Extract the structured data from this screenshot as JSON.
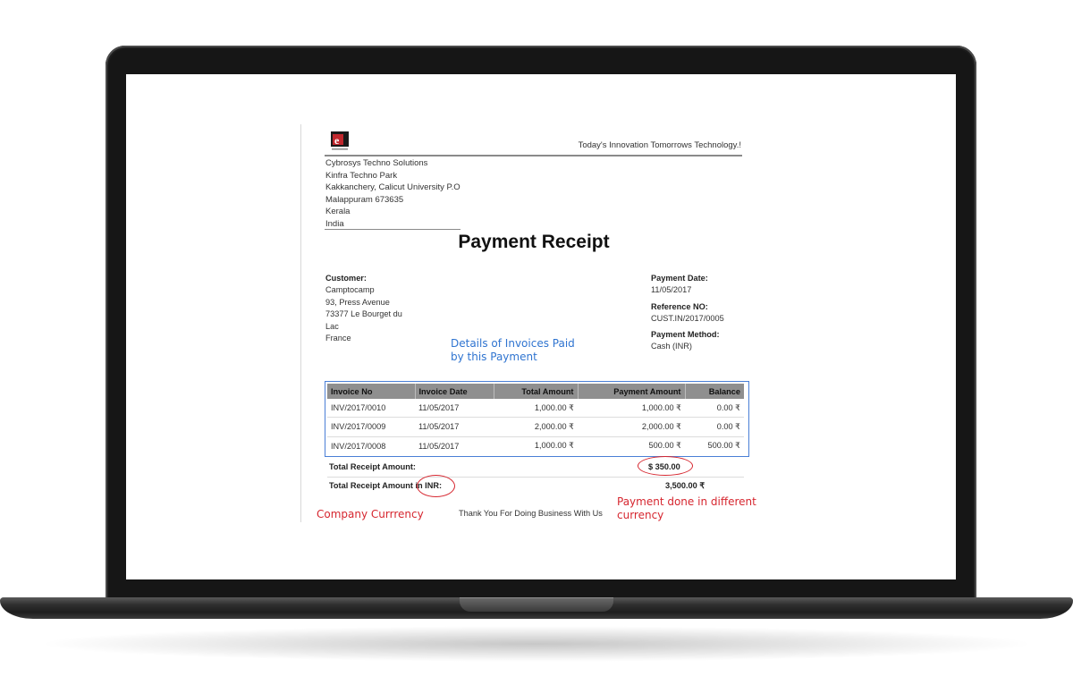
{
  "document": {
    "tagline": "Today's Innovation Tomorrows Technology.!",
    "company_address": [
      "Cybrosys Techno Solutions",
      "Kinfra Techno Park",
      "Kakkanchery, Calicut University P.O",
      "Malappuram 673635",
      "Kerala",
      "India"
    ],
    "title": "Payment Receipt",
    "customer": {
      "label": "Customer:",
      "lines": [
        "Camptocamp",
        "93, Press Avenue",
        "73377 Le Bourget du",
        "Lac",
        "France"
      ]
    },
    "payment_date": {
      "label": "Payment Date:",
      "value": "11/05/2017"
    },
    "reference": {
      "label": "Reference NO:",
      "value": "CUST.IN/2017/0005"
    },
    "payment_method": {
      "label": "Payment Method:",
      "value": "Cash (INR)"
    },
    "table": {
      "headers": [
        "Invoice No",
        "Invoice Date",
        "Total Amount",
        "Payment Amount",
        "Balance"
      ],
      "rows": [
        [
          "INV/2017/0010",
          "11/05/2017",
          "1,000.00 ₹",
          "1,000.00 ₹",
          "0.00 ₹"
        ],
        [
          "INV/2017/0009",
          "11/05/2017",
          "2,000.00 ₹",
          "2,000.00 ₹",
          "0.00 ₹"
        ],
        [
          "INV/2017/0008",
          "11/05/2017",
          "1,000.00 ₹",
          "500.00 ₹",
          "500.00 ₹"
        ]
      ]
    },
    "totals": {
      "receipt_label": "Total Receipt Amount:",
      "receipt_value": "$ 350.00",
      "inr_label_prefix": "Total Receipt Amount ",
      "inr_label_suffix": "in INR:",
      "inr_value": "3,500.00 ₹"
    },
    "thank_you": "Thank You For Doing Business With Us"
  },
  "annotations": {
    "invoices_note": [
      "Details of Invoices Paid",
      "by this Payment"
    ],
    "company_currency": "Company Currrency",
    "different_currency": [
      "Payment done in different",
      "currency"
    ]
  },
  "colors": {
    "annotation_blue": "#2f74d0",
    "annotation_red": "#d6262f",
    "table_header": "#8f8f8f"
  }
}
